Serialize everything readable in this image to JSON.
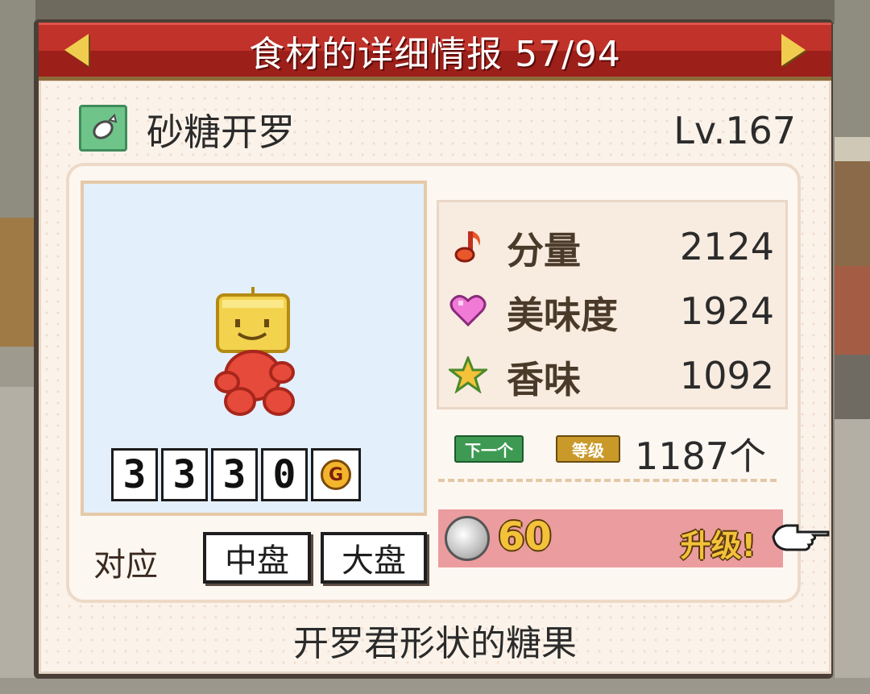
{
  "title": {
    "text": "食材的详细情报 57/94"
  },
  "ingredient": {
    "name": "砂糖开罗",
    "level": "Lv.167",
    "icon": "candy-icon",
    "price_digits": [
      "3",
      "3",
      "3",
      "0"
    ],
    "currency": "G",
    "dish_label": "对应",
    "dishes": [
      "中盘",
      "大盘"
    ],
    "description": "开罗君形状的糖果"
  },
  "stats": [
    {
      "icon": "music-note-icon",
      "label": "分量",
      "value": "2124"
    },
    {
      "icon": "heart-icon",
      "label": "美味度",
      "value": "1924"
    },
    {
      "icon": "star-icon",
      "label": "香味",
      "value": "1092"
    }
  ],
  "next_level": {
    "tag": "下一个",
    "lvup_tag": "等级",
    "count": "1187个"
  },
  "upgrade": {
    "cost": "60",
    "label": "升级!"
  }
}
